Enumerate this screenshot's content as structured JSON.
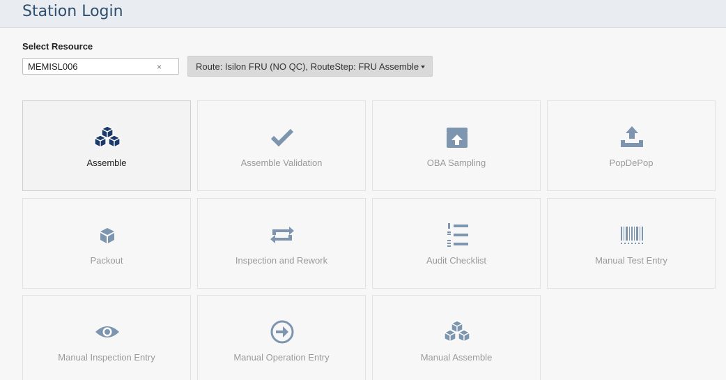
{
  "header": {
    "title": "Station Login"
  },
  "resource": {
    "label": "Select Resource",
    "value": "MEMISL006",
    "clear_glyph": "×"
  },
  "route": {
    "selected": "Route: Isilon FRU (NO QC), RouteStep: FRU Assemble"
  },
  "tiles": [
    {
      "label": "Assemble",
      "icon": "cubes-icon",
      "active": true,
      "color": "#1b3a6b"
    },
    {
      "label": "Assemble Validation",
      "icon": "checkmark-icon",
      "color": "#7e95b0"
    },
    {
      "label": "OBA Sampling",
      "icon": "archive-upload-icon",
      "color": "#7e95b0"
    },
    {
      "label": "PopDePop",
      "icon": "tray-upload-icon",
      "color": "#7e95b0"
    },
    {
      "label": "Packout",
      "icon": "box-icon",
      "color": "#7e95b0"
    },
    {
      "label": "Inspection and Rework",
      "icon": "retweet-icon",
      "color": "#7e95b0"
    },
    {
      "label": "Audit Checklist",
      "icon": "numbered-list-icon",
      "color": "#7e95b0"
    },
    {
      "label": "Manual Test Entry",
      "icon": "barcode-icon",
      "color": "#7e95b0"
    },
    {
      "label": "Manual Inspection Entry",
      "icon": "eye-icon",
      "color": "#7e95b0"
    },
    {
      "label": "Manual Operation Entry",
      "icon": "arrow-circle-right-icon",
      "color": "#7e95b0"
    },
    {
      "label": "Manual Assemble",
      "icon": "cubes-icon",
      "color": "#7e95b0"
    }
  ]
}
